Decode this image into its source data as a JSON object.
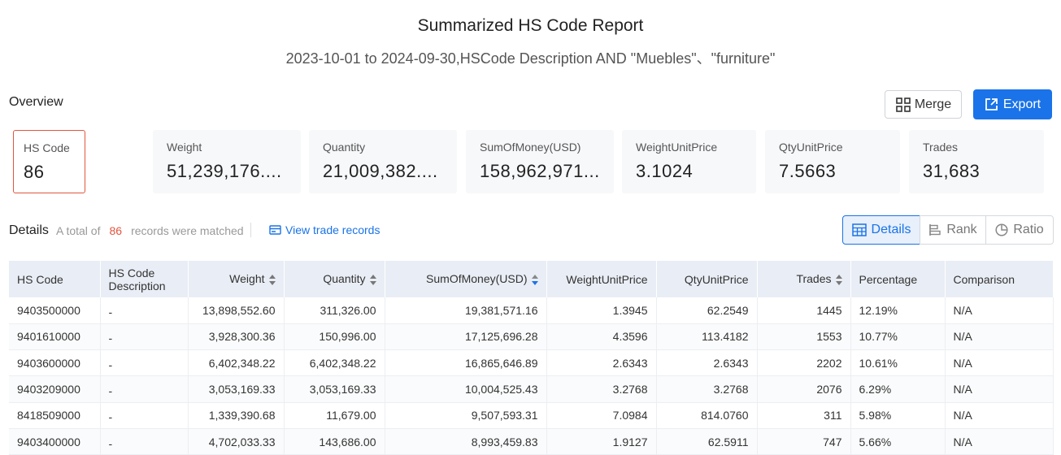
{
  "header": {
    "title": "Summarized HS Code Report",
    "subtitle": "2023-10-01 to 2024-09-30,HSCode Description AND \"Muebles\"、\"furniture\""
  },
  "overview": {
    "label": "Overview",
    "merge_label": "Merge",
    "export_label": "Export",
    "stats": [
      {
        "label": "HS Code",
        "value": "86"
      },
      {
        "label": "Weight",
        "value": "51,239,176...."
      },
      {
        "label": "Quantity",
        "value": "21,009,382...."
      },
      {
        "label": "SumOfMoney(USD)",
        "value": "158,962,971..."
      },
      {
        "label": "WeightUnitPrice",
        "value": "3.1024"
      },
      {
        "label": "QtyUnitPrice",
        "value": "7.5663"
      },
      {
        "label": "Trades",
        "value": "31,683"
      }
    ]
  },
  "details": {
    "label": "Details",
    "matched_prefix": "A total of",
    "matched_count": "86",
    "matched_suffix": "records were matched",
    "view_trade": "View trade records",
    "views": [
      "Details",
      "Rank",
      "Ratio"
    ],
    "active_view": "Details"
  },
  "table": {
    "columns": [
      "HS Code",
      "HS Code Description",
      "Weight",
      "Quantity",
      "SumOfMoney(USD)",
      "WeightUnitPrice",
      "QtyUnitPrice",
      "Trades",
      "Percentage",
      "Comparison"
    ],
    "rows": [
      [
        "9403500000",
        "-",
        "13,898,552.60",
        "311,326.00",
        "19,381,571.16",
        "1.3945",
        "62.2549",
        "1445",
        "12.19%",
        "N/A"
      ],
      [
        "9401610000",
        "-",
        "3,928,300.36",
        "150,996.00",
        "17,125,696.28",
        "4.3596",
        "113.4182",
        "1553",
        "10.77%",
        "N/A"
      ],
      [
        "9403600000",
        "-",
        "6,402,348.22",
        "6,402,348.22",
        "16,865,646.89",
        "2.6343",
        "2.6343",
        "2202",
        "10.61%",
        "N/A"
      ],
      [
        "9403209000",
        "-",
        "3,053,169.33",
        "3,053,169.33",
        "10,004,525.43",
        "3.2768",
        "3.2768",
        "2076",
        "6.29%",
        "N/A"
      ],
      [
        "8418509000",
        "-",
        "1,339,390.68",
        "11,679.00",
        "9,507,593.31",
        "7.0984",
        "814.0760",
        "311",
        "5.98%",
        "N/A"
      ],
      [
        "9403400000",
        "-",
        "4,702,033.33",
        "143,686.00",
        "8,993,459.83",
        "1.9127",
        "62.5911",
        "747",
        "5.66%",
        "N/A"
      ]
    ]
  },
  "colors": {
    "accent": "#1a73e8",
    "highlight": "#e2553f"
  },
  "icons": {
    "merge": "merge-icon",
    "export": "export-icon",
    "view_trade": "card-icon",
    "details": "table-icon",
    "rank": "bar-rank-icon",
    "ratio": "pie-icon"
  }
}
